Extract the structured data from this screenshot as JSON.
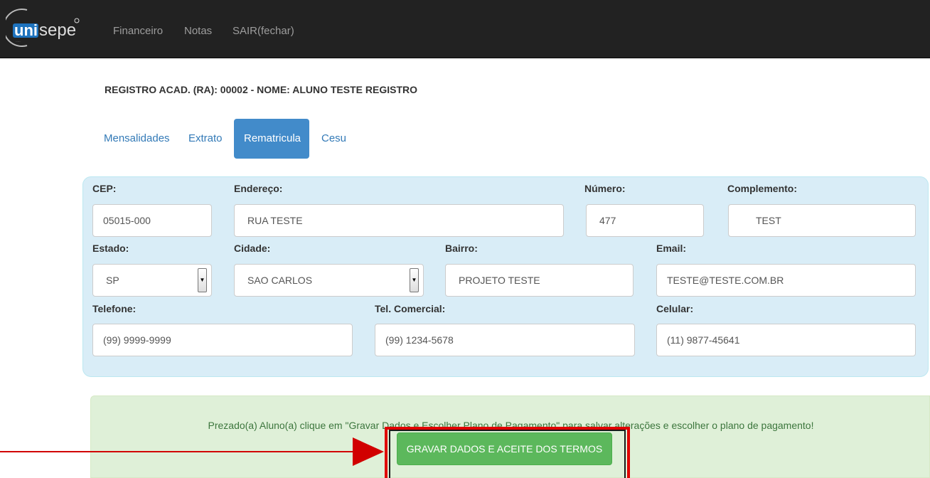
{
  "nav": {
    "logo_text": "unisepe",
    "links": [
      "Financeiro",
      "Notas",
      "SAIR(fechar)"
    ]
  },
  "student": {
    "header": "REGISTRO ACAD. (RA): 00002 - NOME: ALUNO TESTE REGISTRO"
  },
  "tabs": [
    {
      "label": "Mensalidades",
      "active": false
    },
    {
      "label": "Extrato",
      "active": false
    },
    {
      "label": "Rematricula",
      "active": true
    },
    {
      "label": "Cesu",
      "active": false
    }
  ],
  "form": {
    "cep": {
      "label": "CEP:",
      "value": "05015-000"
    },
    "endereco": {
      "label": "Endereço:",
      "value": "RUA TESTE"
    },
    "numero": {
      "label": "Número:",
      "value": "477"
    },
    "complemento": {
      "label": "Complemento:",
      "value": "TEST"
    },
    "estado": {
      "label": "Estado:",
      "value": "SP"
    },
    "cidade": {
      "label": "Cidade:",
      "value": "SAO CARLOS"
    },
    "bairro": {
      "label": "Bairro:",
      "value": "PROJETO TESTE"
    },
    "email": {
      "label": "Email:",
      "value": "TESTE@TESTE.COM.BR"
    },
    "telefone": {
      "label": "Telefone:",
      "value": "(99) 9999-9999"
    },
    "tel_comercial": {
      "label": "Tel. Comercial:",
      "value": "(99) 1234-5678"
    },
    "celular": {
      "label": "Celular:",
      "value": "(11) 9877-45641"
    }
  },
  "alert": {
    "message": "Prezado(a) Aluno(a) clique em \"Gravar Dados e Escolher Plano de Pagamento\" para salvar alterações e escolher o plano de pagamento!",
    "button_label": "GRAVAR DADOS E ACEITE DOS TERMOS"
  },
  "colors": {
    "navbar": "#222222",
    "tab_active": "#428bca",
    "panel": "#d9edf7",
    "alert": "#dff0d8",
    "button": "#5cb85c",
    "annotation": "#d10000"
  }
}
